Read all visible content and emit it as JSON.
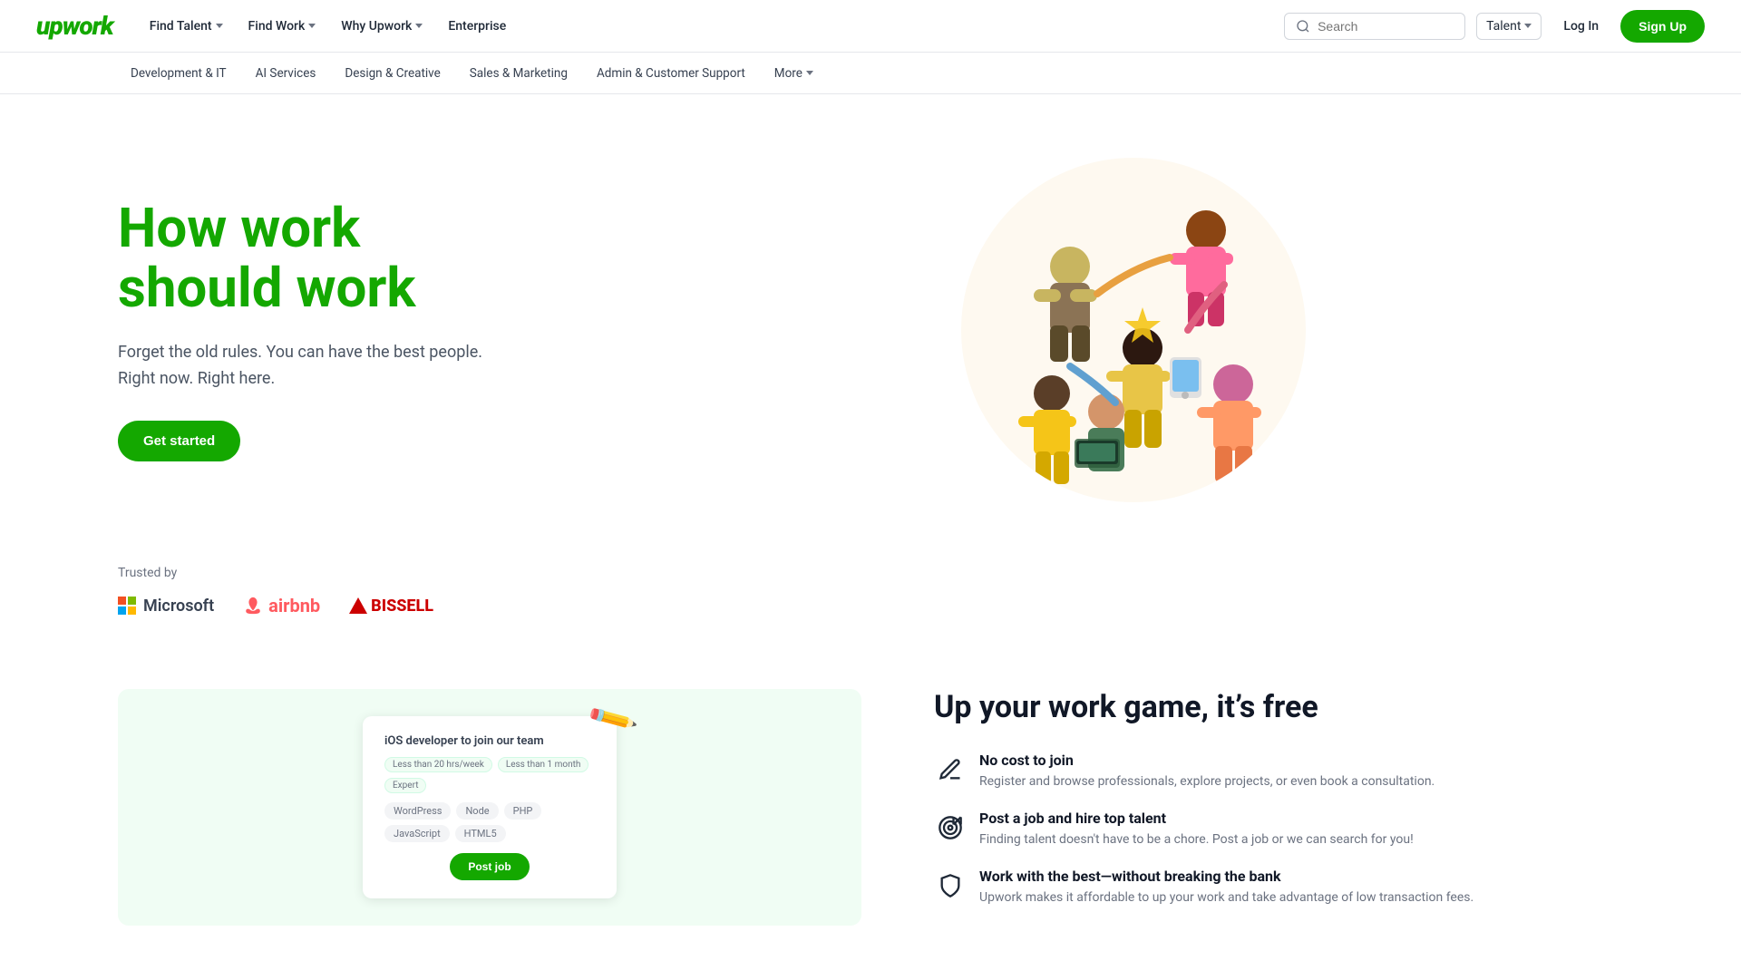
{
  "header": {
    "logo": "upwork",
    "nav": [
      {
        "label": "Find Talent",
        "hasDropdown": true
      },
      {
        "label": "Find Work",
        "hasDropdown": true
      },
      {
        "label": "Why Upwork",
        "hasDropdown": true
      },
      {
        "label": "Enterprise",
        "hasDropdown": false
      }
    ],
    "search": {
      "placeholder": "Search",
      "talent_label": "Talent"
    },
    "login_label": "Log In",
    "signup_label": "Sign Up"
  },
  "sub_nav": {
    "items": [
      {
        "label": "Development & IT"
      },
      {
        "label": "AI Services"
      },
      {
        "label": "Design & Creative"
      },
      {
        "label": "Sales & Marketing"
      },
      {
        "label": "Admin & Customer Support"
      },
      {
        "label": "More"
      }
    ]
  },
  "hero": {
    "title_line1": "How work",
    "title_line2": "should work",
    "subtitle_line1": "Forget the old rules. You can have the best people.",
    "subtitle_line2": "Right now. Right here.",
    "cta_label": "Get started"
  },
  "trusted": {
    "label": "Trusted by",
    "logos": [
      {
        "name": "Microsoft"
      },
      {
        "name": "airbnb"
      },
      {
        "name": "BISSELL"
      }
    ]
  },
  "bottom_section": {
    "title": "Up your work game, it’s free",
    "features": [
      {
        "icon": "pencil-icon",
        "title": "No cost to join",
        "description": "Register and browse professionals, explore projects, or even book a consultation."
      },
      {
        "icon": "target-icon",
        "title": "Post a job and hire top talent",
        "description": "Finding talent doesn't have to be a chore. Post a job or we can search for you!"
      },
      {
        "icon": "shield-icon",
        "title": "Work with the best—without breaking the bank",
        "description": "Upwork makes it affordable to up your work and take advantage of low transaction fees."
      }
    ],
    "job_card": {
      "title": "iOS developer to join our team",
      "filters": [
        "Less than 20 hrs/week",
        "Less than 1 month",
        "Expert"
      ],
      "tags": [
        "WordPress",
        "Node",
        "PHP",
        "JavaScript",
        "HTML5"
      ],
      "button_label": "Post job"
    }
  }
}
